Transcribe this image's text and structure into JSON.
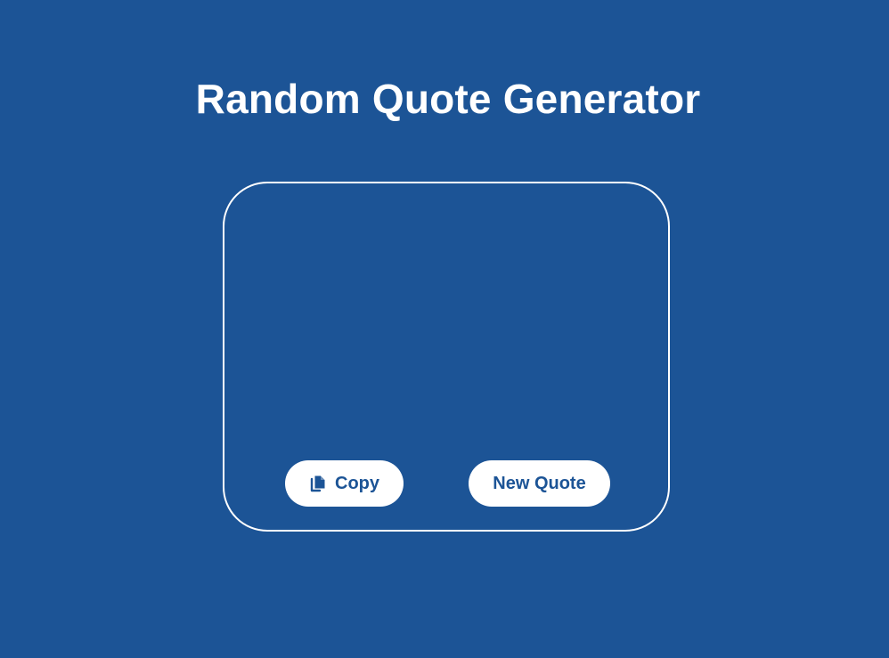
{
  "header": {
    "title": "Random Quote Generator"
  },
  "quote": {
    "text": ""
  },
  "actions": {
    "copy_label": "Copy",
    "copy_icon": "copy-icon",
    "new_quote_label": "New Quote"
  },
  "colors": {
    "background": "#1c5496",
    "foreground": "#ffffff"
  }
}
